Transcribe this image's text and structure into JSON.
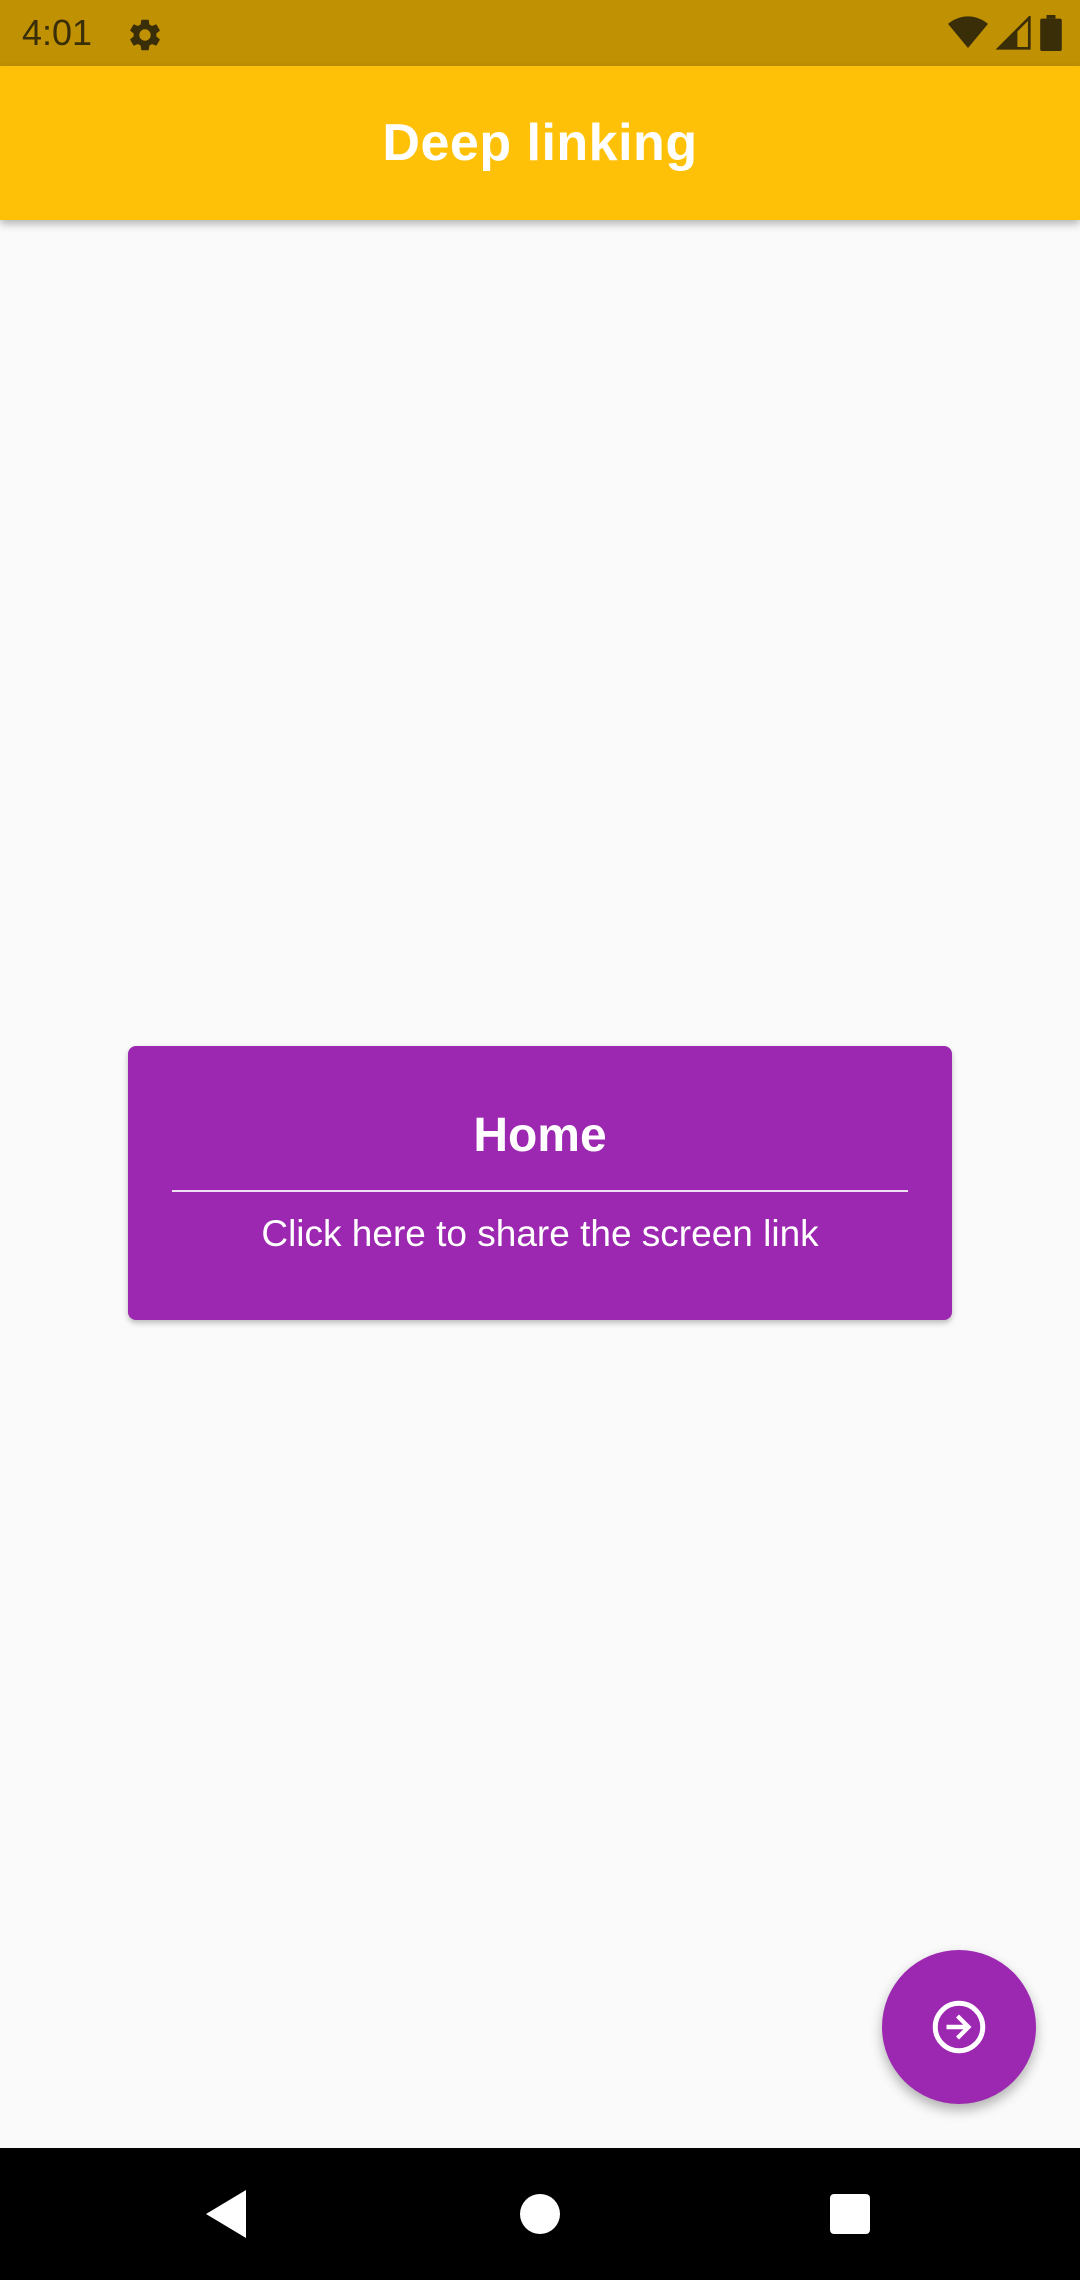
{
  "status_bar": {
    "time": "4:01",
    "icons": [
      "gear-icon",
      "wifi-icon",
      "cellular-signal-icon",
      "battery-icon"
    ]
  },
  "app_bar": {
    "title": "Deep linking",
    "color": "#ffc107"
  },
  "card": {
    "title": "Home",
    "subtitle": "Click here to share the screen link",
    "color": "#9c27b0"
  },
  "fab": {
    "icon": "arrow-right-circle-icon",
    "color": "#9c27b0"
  },
  "nav_bar": {
    "buttons": [
      "back-icon",
      "home-icon",
      "recents-icon"
    ]
  }
}
